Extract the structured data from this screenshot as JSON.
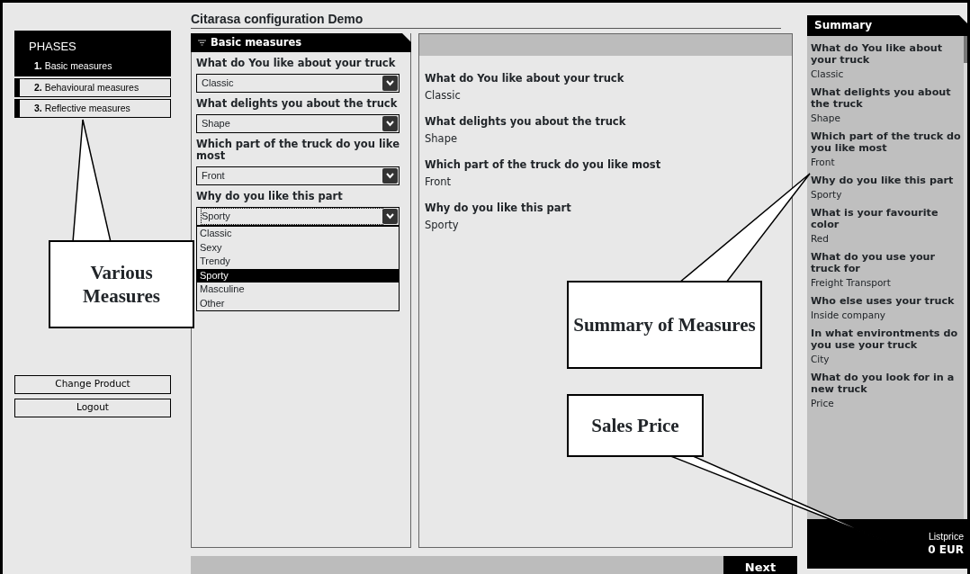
{
  "title": "Citarasa configuration Demo",
  "phases": {
    "heading": "PHASES",
    "items": [
      {
        "number": "1.",
        "label": "Basic measures",
        "selected": true
      },
      {
        "number": "2.",
        "label": "Behavioural measures",
        "selected": false
      },
      {
        "number": "3.",
        "label": "Reflective measures",
        "selected": false
      }
    ]
  },
  "actions": [
    "Change Product",
    "Logout"
  ],
  "form": {
    "title": "Basic measures",
    "questions": [
      {
        "label": "What do You like about your truck",
        "value": "Classic",
        "expanded": false
      },
      {
        "label": "What delights you about the truck",
        "value": "Shape",
        "expanded": false
      },
      {
        "label": "Which part of the truck do you like most",
        "value": "Front",
        "expanded": false
      },
      {
        "label": "Why do you like this part",
        "value": "Sporty",
        "expanded": true,
        "options": [
          {
            "label": "Classic",
            "selected": false
          },
          {
            "label": "Sexy",
            "selected": false
          },
          {
            "label": "Trendy",
            "selected": false
          },
          {
            "label": "Sporty",
            "selected": true
          },
          {
            "label": "Masculine",
            "selected": false
          },
          {
            "label": "Other",
            "selected": false
          }
        ]
      }
    ]
  },
  "answers": [
    {
      "question": "What do You like about your truck",
      "answer": "Classic"
    },
    {
      "question": "What delights you about the truck",
      "answer": "Shape"
    },
    {
      "question": "Which part of the truck do you like most",
      "answer": "Front"
    },
    {
      "question": "Why do you like this part",
      "answer": "Sporty"
    }
  ],
  "next_button": "Next",
  "summary": {
    "title": "Summary",
    "items": [
      {
        "question": "What do You like about your truck",
        "answer": "Classic"
      },
      {
        "question": "What delights you about the truck",
        "answer": "Shape"
      },
      {
        "question": "Which part of the truck do you like most",
        "answer": "Front"
      },
      {
        "question": "Why do you like this part",
        "answer": "Sporty"
      },
      {
        "question": "What is your favourite color",
        "answer": "Red"
      },
      {
        "question": "What do you use your truck for",
        "answer": "Freight Transport"
      },
      {
        "question": "Who else uses your truck",
        "answer": "Inside company"
      },
      {
        "question": "In what environtments do you use your truck",
        "answer": "City"
      },
      {
        "question": "What do you look for in a new truck",
        "answer": "Price"
      }
    ],
    "price_label": "Listprice",
    "price": "0 EUR"
  },
  "annotations": [
    {
      "text": "Various Measures"
    },
    {
      "text": "Summary of Measures"
    },
    {
      "text": "Sales Price"
    }
  ]
}
